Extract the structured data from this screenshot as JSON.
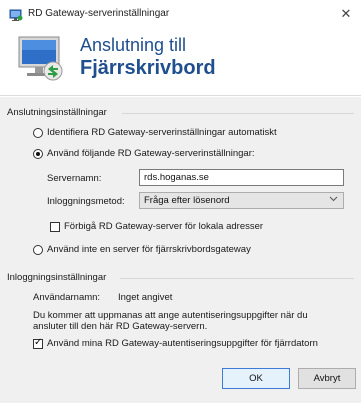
{
  "window": {
    "title": "RD Gateway-serverinställningar",
    "close_glyph": "✕"
  },
  "banner": {
    "line1": "Anslutning till",
    "line2": "Fjärrskrivbord"
  },
  "connection_settings": {
    "group_title": "Anslutningsinställningar",
    "radio_auto": "Identifiera RD Gateway-serverinställningar automatiskt",
    "radio_use": "Använd följande RD Gateway-serverinställningar:",
    "servername_label": "Servernamn:",
    "servername_value": "rds.hoganas.se",
    "logon_method_label": "Inloggningsmetod:",
    "logon_method_value": "Fråga efter lösenord",
    "bypass_local": "Förbigå RD Gateway-server för lokala adresser",
    "radio_none": "Använd inte en server för fjärrskrivbordsgateway",
    "selected": "use",
    "bypass_checked": false
  },
  "logon_settings": {
    "group_title": "Inloggningsinställningar",
    "username_label": "Användarnamn:",
    "username_value": "Inget angivet",
    "info_line1": "Du kommer att uppmanas att ange autentiseringsuppgifter när du",
    "info_line2": "ansluter till den här RD Gateway-servern.",
    "use_credentials": "Använd mina RD Gateway-autentiseringsuppgifter för fjärrdatorn",
    "use_credentials_checked": true
  },
  "buttons": {
    "ok": "OK",
    "cancel": "Avbryt"
  },
  "icons": {
    "title_icon": "remote-desktop-icon",
    "banner_logo": "remote-desktop-logo-icon",
    "dropdown": "chevron-down-icon"
  },
  "colors": {
    "banner_text": "#1f4f8f",
    "dialog_bg": "#f0f0f0",
    "default_button_border": "#3d7bd7"
  }
}
